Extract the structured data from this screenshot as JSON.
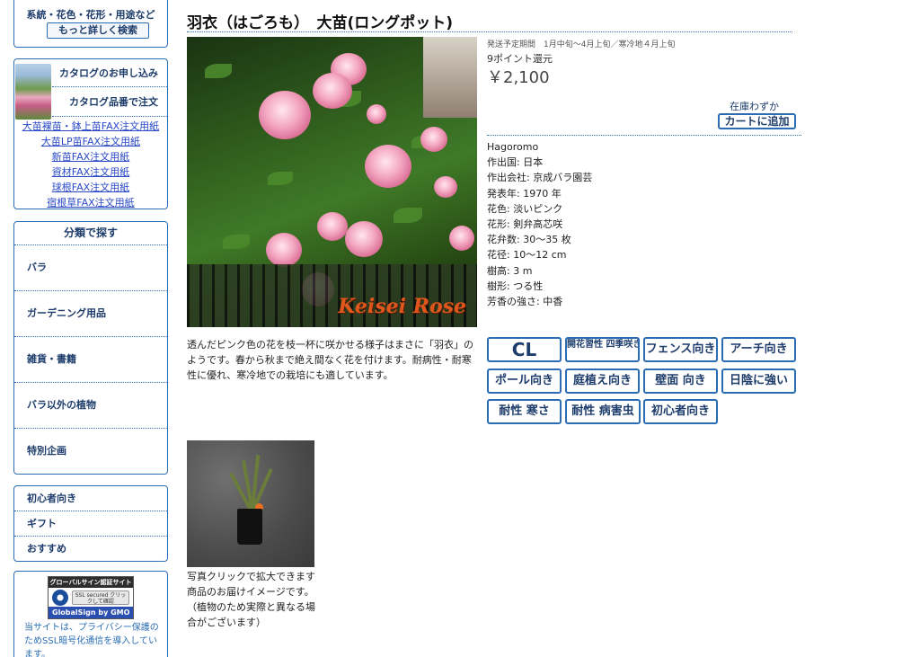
{
  "sidebar": {
    "search": {
      "label": "系統・花色・花形・用途など",
      "button": "もっと詳しく検索"
    },
    "catalog": {
      "request": "カタログのお申し込み",
      "order_by_number": "カタログ品番で注文",
      "fax_links": [
        "大苗裸苗・鉢上苗FAX注文用紙",
        "大苗LP苗FAX注文用紙",
        "新苗FAX注文用紙",
        "資材FAX注文用紙",
        "球根FAX注文用紙",
        "宿根草FAX注文用紙"
      ]
    },
    "classify": {
      "heading": "分類で探す",
      "items": [
        "バラ",
        "ガーデニング用品",
        "雑貨・書籍",
        "バラ以外の植物",
        "特別企画"
      ]
    },
    "features": [
      "初心者向き",
      "ギフト",
      "おすすめ"
    ],
    "ssl": {
      "badge_top": "グローバルサイン認証サイト",
      "badge_lock": "SSL secured クリックして確認",
      "badge_bottom": "GlobalSign by GMO",
      "text": "当サイトは、プライバシー保護のためSSL暗号化通信を導入しています。"
    }
  },
  "product": {
    "title": "羽衣（はごろも）　大苗(ロングポット)",
    "photo_caption": "Keisei Rose",
    "shipping": "発送予定期間　1月中旬～4月上旬／寒冷地４月上旬",
    "points": "9ポイント還元",
    "price": "￥2,100",
    "stock": "在庫わずか",
    "cart_button": "カートに追加",
    "specs": [
      "Hagoromo",
      "作出国: 日本",
      "作出会社: 京成バラ園芸",
      "発表年: 1970 年",
      "花色: 淡いピンク",
      "花形: 剣弁高芯咲",
      "花弁数: 30～35 枚",
      "花径: 10～12 cm",
      "樹高: 3 m",
      "樹形: つる性",
      "芳香の強さ: 中香"
    ],
    "description": "透んだピンク色の花を枝一杯に咲かせる様子はまさに「羽衣」のようです。春から秋まで絶え間なく花を付けます。耐病性・耐寒性に優れ、寒冷地での栽培にも適しています。",
    "tags": [
      "CL",
      "開花習性 四季咲き",
      "フェンス向き",
      "アーチ向き",
      "ポール向き",
      "庭植え向き",
      "壁面 向き",
      "日陰に強い",
      "耐性 寒さ",
      "耐性 病害虫",
      "初心者向き"
    ],
    "thumb_caption": [
      "写真クリックで拡大できます",
      "商品のお届けイメージです。",
      "（植物のため実際と異なる場合がございます）"
    ]
  }
}
